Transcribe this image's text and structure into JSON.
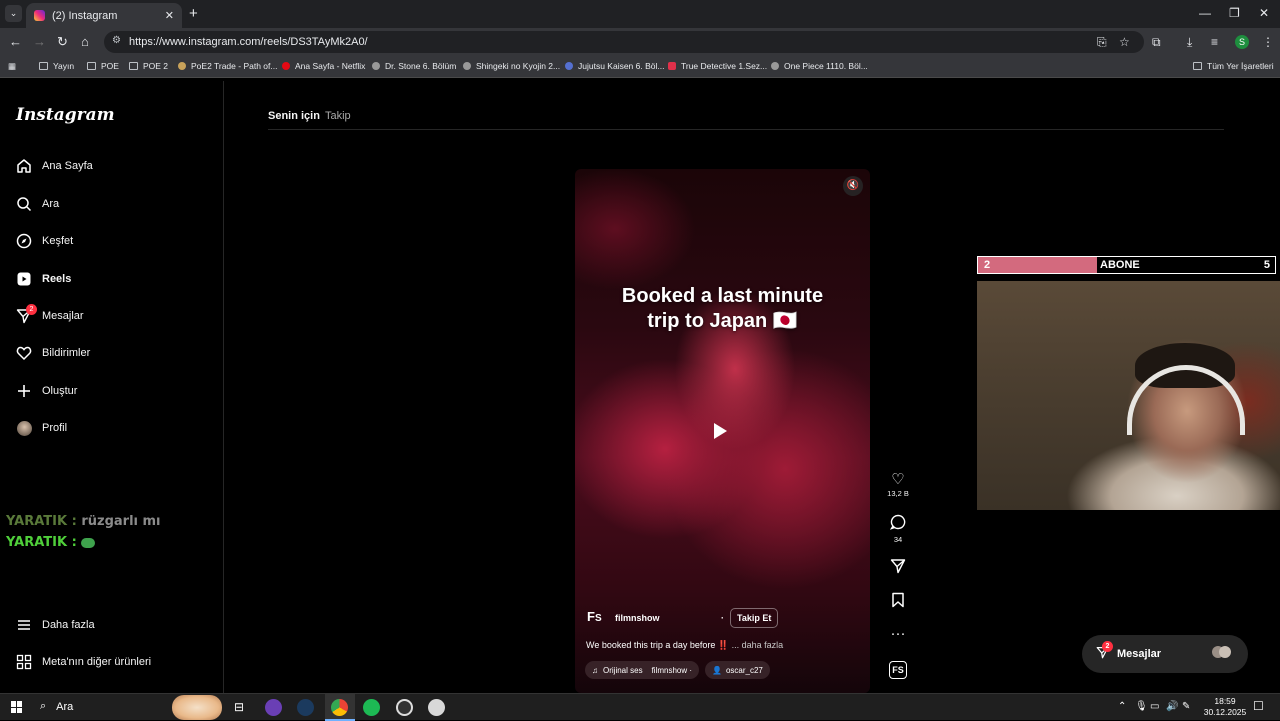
{
  "browser": {
    "tab_title": "(2) Instagram",
    "url": "https://www.instagram.com/reels/DS3TAyMk2A0/",
    "profile_initial": "S",
    "bookmarks": [
      "Yayın",
      "POE",
      "POE 2",
      "PoE2 Trade - Path of...",
      "Ana Sayfa - Netflix",
      "Dr. Stone 6. Bölüm",
      "Shingeki no Kyojin 2...",
      "Jujutsu Kaisen 6. Böl...",
      "True Detective 1.Sez...",
      "One Piece 1110. Böl..."
    ],
    "all_bookmarks": "Tüm Yer İşaretleri"
  },
  "sidebar": {
    "logo": "Instagram",
    "items": [
      {
        "label": "Ana Sayfa",
        "icon": "home-icon"
      },
      {
        "label": "Ara",
        "icon": "search-icon"
      },
      {
        "label": "Keşfet",
        "icon": "explore-icon"
      },
      {
        "label": "Reels",
        "icon": "reels-icon"
      },
      {
        "label": "Mesajlar",
        "icon": "messages-icon",
        "badge": "2"
      },
      {
        "label": "Bildirimler",
        "icon": "heart-icon"
      },
      {
        "label": "Oluştur",
        "icon": "plus-icon"
      },
      {
        "label": "Profil",
        "icon": "avatar"
      }
    ],
    "more": "Daha fazla",
    "meta": "Meta'nın diğer ürünleri"
  },
  "chat_overlay": [
    {
      "user": "YARATIK",
      "text": "rüzgarlı mı"
    },
    {
      "user": "YARATIK",
      "text": ""
    }
  ],
  "feed_tabs": [
    "Senin için",
    "Takip"
  ],
  "reel": {
    "text_line1": "Booked a last minute",
    "text_line2": "trip to Japan 🇯🇵",
    "account": "filmnshow",
    "follow": "Takip Et",
    "caption": "We booked this trip a day before ‼️",
    "caption_more": "... daha fazla",
    "audio": "Orijinal ses",
    "audio_account": "filmnshow ·",
    "tagged": "oscar_c27",
    "likes": "13,2 B",
    "comments": "34"
  },
  "messages_pill": {
    "label": "Mesajlar",
    "badge": "2"
  },
  "sub_goal": {
    "current": "2",
    "label": "ABONE",
    "goal": "5",
    "progress": 0.4
  },
  "taskbar": {
    "search": "Ara",
    "time": "18:59",
    "date": "30.12.2025"
  },
  "colors": {
    "subfill": "#d36a7e",
    "badge": "#ff3040",
    "chat_green": "#5a7a3a"
  }
}
